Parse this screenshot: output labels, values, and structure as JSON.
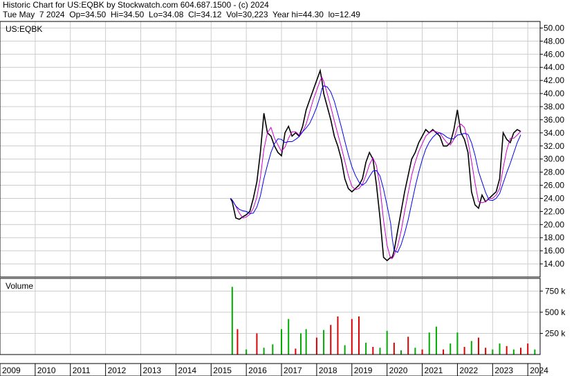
{
  "header": {
    "line1": "Historic Chart for US:EQBK by Stockwatch.com 604.687.1500 - (c) 2024",
    "line2": "Tue May  7 2024  Op=34.50  Hi=34.50  Lo=34.08  Cl=34.12  Vol=30,223  Year hi=44.30  lo=12.49"
  },
  "price_panel": {
    "symbol": "US:EQBK"
  },
  "volume_panel": {
    "label": "Volume"
  },
  "colors": {
    "price": "#000000",
    "ma_short": "#cc00cc",
    "ma_long": "#0000ee",
    "vol_up": "#00aa00",
    "vol_down": "#dd0000",
    "grid": "#cccccc"
  },
  "chart_data": [
    {
      "type": "line",
      "title": "US:EQBK",
      "y_ticks": [
        "14.00",
        "16.00",
        "18.00",
        "20.00",
        "22.00",
        "24.00",
        "26.00",
        "28.00",
        "30.00",
        "32.00",
        "34.00",
        "36.00",
        "38.00",
        "40.00",
        "42.00",
        "44.00",
        "46.00",
        "48.00",
        "50.00"
      ],
      "ylim": [
        12,
        51
      ],
      "xlim": [
        2009,
        2024.35
      ],
      "x_ticks": [
        "2009",
        "2010",
        "2011",
        "2012",
        "2013",
        "2014",
        "2015",
        "2016",
        "2017",
        "2018",
        "2019",
        "2020",
        "2021",
        "2022",
        "2023",
        "2024"
      ],
      "series": [
        {
          "values_x": [
            2015.55,
            2015.6,
            2015.7,
            2015.8,
            2015.9,
            2016.0,
            2016.1,
            2016.2,
            2016.3,
            2016.4,
            2016.5,
            2016.6,
            2016.7,
            2016.8,
            2016.9,
            2017.0,
            2017.1,
            2017.2,
            2017.3,
            2017.4,
            2017.5,
            2017.6,
            2017.7,
            2017.8,
            2017.9,
            2018.0,
            2018.1,
            2018.15,
            2018.2,
            2018.3,
            2018.4,
            2018.5,
            2018.6,
            2018.7,
            2018.8,
            2018.9,
            2019.0,
            2019.1,
            2019.2,
            2019.3,
            2019.4,
            2019.5,
            2019.6,
            2019.7,
            2019.8,
            2019.9,
            2020.0,
            2020.1,
            2020.15,
            2020.2,
            2020.3,
            2020.4,
            2020.5,
            2020.6,
            2020.7,
            2020.8,
            2020.9,
            2021.0,
            2021.1,
            2021.2,
            2021.3,
            2021.4,
            2021.5,
            2021.6,
            2021.7,
            2021.8,
            2021.9,
            2022.0,
            2022.1,
            2022.2,
            2022.3,
            2022.4,
            2022.5,
            2022.6,
            2022.7,
            2022.8,
            2022.9,
            2023.0,
            2023.1,
            2023.2,
            2023.3,
            2023.4,
            2023.5,
            2023.6,
            2023.7,
            2023.8,
            2023.9,
            2024.0,
            2024.1,
            2024.2,
            2024.3
          ],
          "values_y": [
            24,
            23.5,
            21,
            20.8,
            21.2,
            21.5,
            22,
            24,
            26.5,
            31,
            37,
            34,
            33.5,
            32,
            31,
            30.5,
            34,
            35,
            33.5,
            34,
            33.5,
            35,
            37.5,
            39,
            40.5,
            42,
            43.5,
            42,
            40,
            38,
            36,
            33.5,
            32,
            30,
            27,
            25.5,
            25,
            25.5,
            26,
            27,
            29.5,
            31,
            30,
            26,
            21,
            15,
            14.5,
            15,
            15,
            16,
            19,
            22,
            25,
            27.5,
            30,
            31,
            32.5,
            33.5,
            34.5,
            34,
            34.5,
            34,
            33.5,
            32,
            32,
            32.5,
            34.5,
            37.5,
            34,
            33,
            31,
            25,
            23,
            22.5,
            24.5,
            23.5,
            24,
            24.5,
            25,
            27,
            34,
            33,
            32.5,
            34,
            34.5,
            34.2
          ],
          "name": ""
        }
      ]
    },
    {
      "type": "bar",
      "title": "Volume",
      "y_ticks": [
        "250 k",
        "500 k",
        "750 k"
      ],
      "ylim": [
        0,
        900
      ],
      "values_x": [
        2015.6,
        2015.75,
        2016.0,
        2016.3,
        2016.5,
        2016.75,
        2017.0,
        2017.2,
        2017.4,
        2017.55,
        2017.7,
        2018.0,
        2018.2,
        2018.4,
        2018.6,
        2018.8,
        2019.0,
        2019.2,
        2019.4,
        2019.6,
        2019.8,
        2020.0,
        2020.2,
        2020.4,
        2020.6,
        2020.8,
        2021.0,
        2021.2,
        2021.4,
        2021.6,
        2021.8,
        2022.0,
        2022.2,
        2022.4,
        2022.6,
        2022.8,
        2023.0,
        2023.2,
        2023.4,
        2023.6,
        2023.8,
        2024.0,
        2024.2
      ],
      "values": [
        800,
        300,
        60,
        250,
        80,
        120,
        300,
        420,
        70,
        250,
        300,
        200,
        290,
        350,
        450,
        110,
        420,
        450,
        140,
        90,
        80,
        280,
        140,
        50,
        210,
        80,
        60,
        260,
        330,
        60,
        130,
        260,
        90,
        160,
        200,
        80,
        60,
        130,
        100,
        60,
        80,
        130,
        60
      ],
      "up": [
        true,
        false,
        true,
        false,
        true,
        true,
        true,
        true,
        false,
        true,
        true,
        false,
        true,
        false,
        false,
        true,
        false,
        false,
        true,
        false,
        true,
        true,
        false,
        true,
        false,
        true,
        false,
        true,
        true,
        false,
        true,
        true,
        false,
        true,
        false,
        false,
        true,
        true,
        false,
        true,
        false,
        false,
        true
      ]
    }
  ]
}
